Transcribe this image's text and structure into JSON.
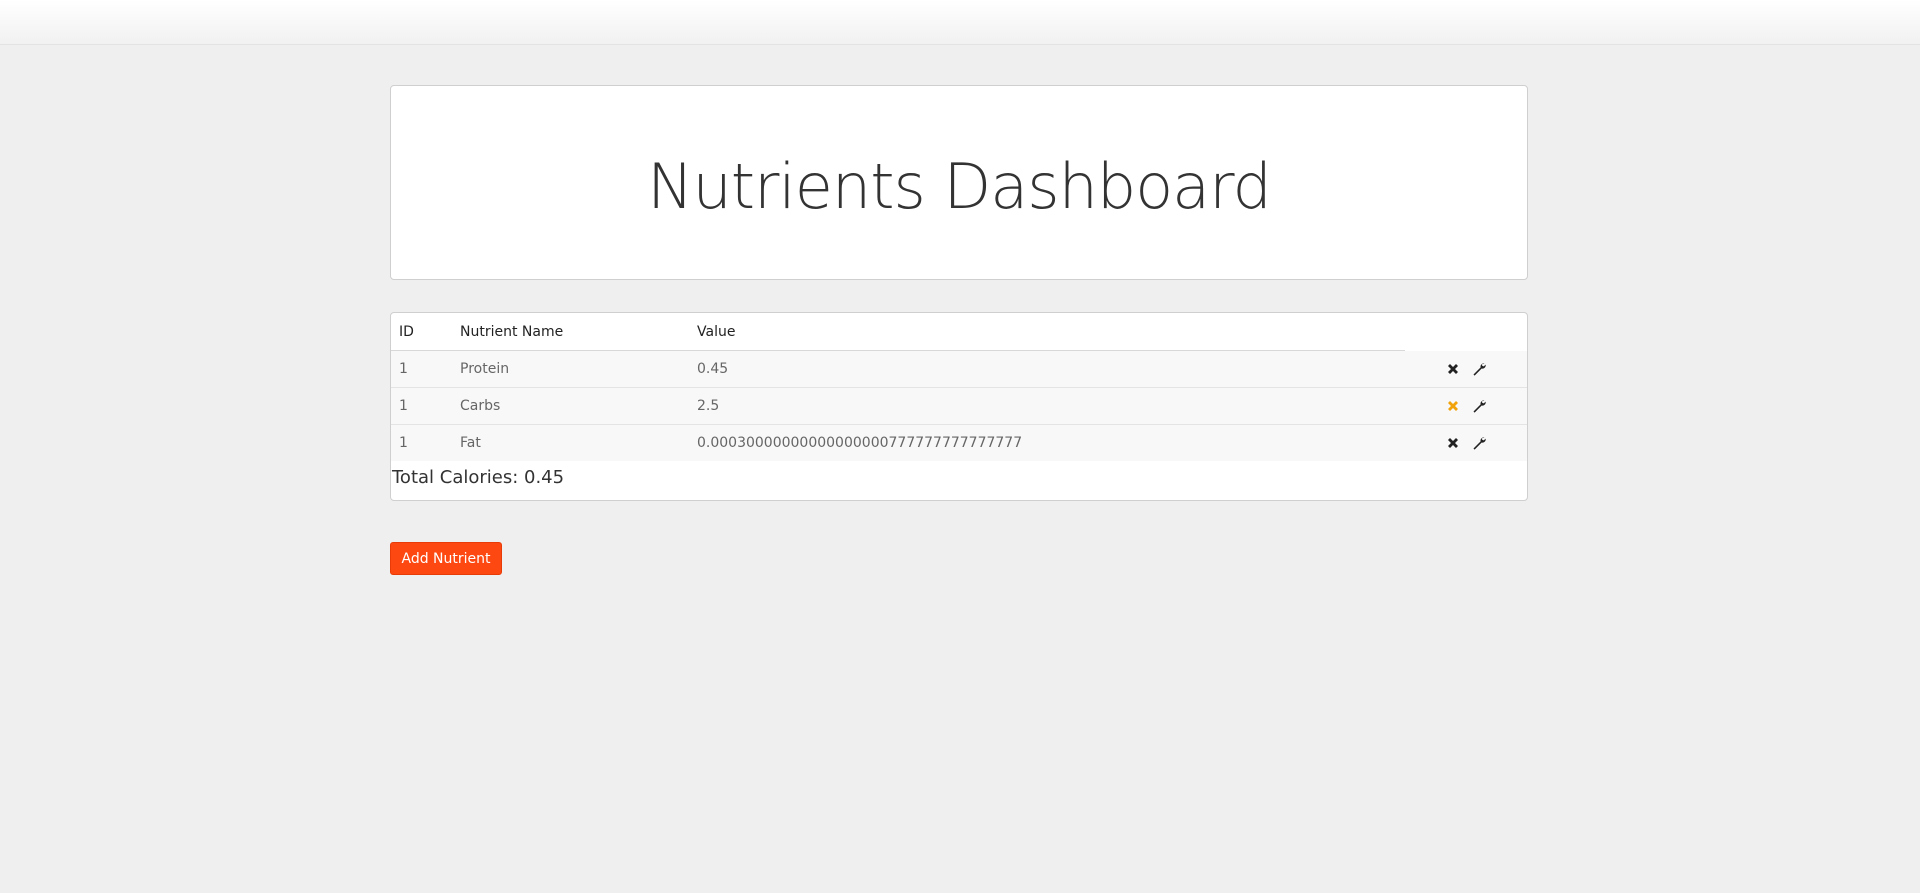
{
  "title": "Nutrients Dashboard",
  "table": {
    "headers": [
      "ID",
      "Nutrient Name",
      "Value",
      ""
    ],
    "rows": [
      {
        "id": "1",
        "name": "Protein",
        "value": "0.45",
        "delete_color": "#222222"
      },
      {
        "id": "1",
        "name": "Carbs",
        "value": "2.5",
        "delete_color": "#f0a30a"
      },
      {
        "id": "1",
        "name": "Fat",
        "value": "0.00030000000000000000777777777777777",
        "delete_color": "#222222"
      }
    ],
    "icons": [
      "close-icon",
      "wrench-icon"
    ]
  },
  "total": "Total Calories: 0.45",
  "add_button_label": "Add Nutrient",
  "colors": {
    "accent": "#fe4811",
    "highlight_icon": "#f0a30a",
    "background": "#efefef"
  }
}
